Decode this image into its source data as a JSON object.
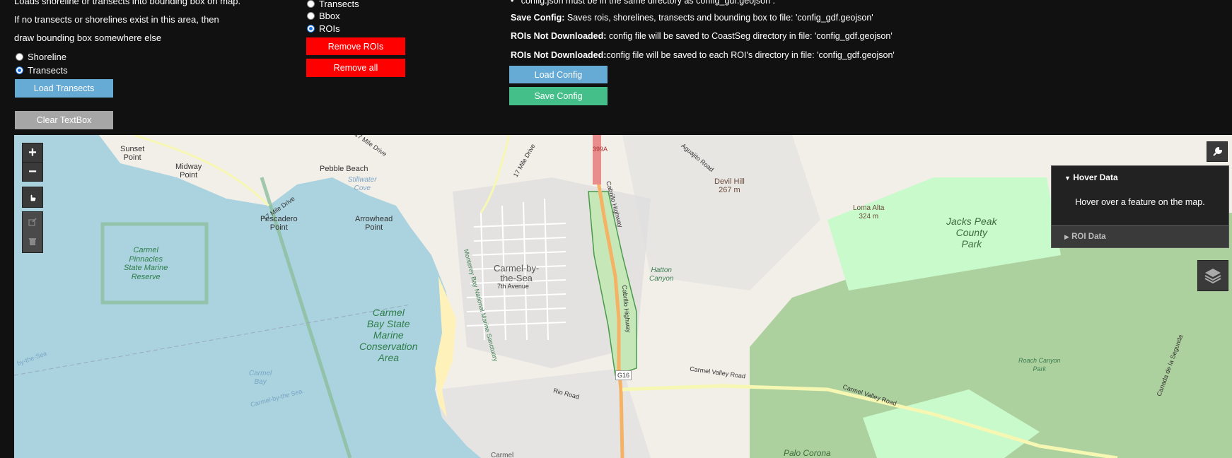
{
  "left_panel": {
    "line1": "Loads shoreline or transects into bounding box on map.",
    "line2": "If no transects or shorelines exist in this area, then",
    "line3": "draw bounding box somewhere else",
    "radio_options": [
      {
        "label": "Shoreline",
        "selected": false
      },
      {
        "label": "Transects",
        "selected": true
      }
    ],
    "load_button": "Load Transects",
    "clear_button": "Clear TextBox"
  },
  "middle_panel": {
    "radio_options": [
      {
        "label": "Transects",
        "selected": false
      },
      {
        "label": "Bbox",
        "selected": false
      },
      {
        "label": "ROIs",
        "selected": true
      }
    ],
    "remove_rois_button": "Remove ROIs",
    "remove_all_button": "Remove all"
  },
  "right_panel": {
    "bullet_text": "config.json  must be in the same directory as  config_gdf.geojson .",
    "save_config_title": "Save Config:",
    "save_config_desc": " Saves rois, shorelines, transects and bounding box to file: 'config_gdf.geojson'",
    "not_downloaded_title_1": "ROIs Not Downloaded:",
    "not_downloaded_desc_1": " config file will be saved to CoastSeg directory in file: 'config_gdf.geojson'",
    "not_downloaded_title_2": "ROIs Not Downloaded:",
    "not_downloaded_desc_2": "config file will be saved to each ROI's directory in file: 'config_gdf.geojson'",
    "load_config_button": "Load Config",
    "save_config_button": "Save Config"
  },
  "map": {
    "zoom_in": "+",
    "zoom_out": "−",
    "hover_panel": {
      "title": "Hover Data",
      "message": "Hover over a feature on the map.",
      "roi_title": "ROI Data"
    },
    "labels": [
      {
        "text": "Sunset\nPoint"
      },
      {
        "text": "Midway\nPoint"
      },
      {
        "text": "Pebble Beach"
      },
      {
        "text": "Stillwater\nCove"
      },
      {
        "text": "Pescadero\nPoint"
      },
      {
        "text": "Arrowhead\nPoint"
      },
      {
        "text": "17 Mile Drive"
      },
      {
        "text": "17 Mile Drive"
      },
      {
        "text": "17 Mile Drive"
      },
      {
        "text": "399A"
      },
      {
        "text": "Aguajito Road"
      },
      {
        "text": "Cabrillo Highway"
      },
      {
        "text": "Devil Hill\n267 m"
      },
      {
        "text": "Loma Alta\n324 m"
      },
      {
        "text": "Carmel-by-\nthe-Sea"
      },
      {
        "text": "7th Avenue"
      },
      {
        "text": "Cabrillo Highway"
      },
      {
        "text": "Hatton\nCanyon"
      },
      {
        "text": "Monterey Bay National Marine Sanctuary"
      },
      {
        "text": "Carmel\nBay"
      },
      {
        "text": "Carmel-by-the Sea"
      },
      {
        "text": "by-the-Sea"
      },
      {
        "text": "G16"
      },
      {
        "text": "Carmel Valley Road"
      },
      {
        "text": "Carmel Valley Road"
      },
      {
        "text": "Rio Road"
      },
      {
        "text": "Carmel"
      },
      {
        "text": "Palo Corona"
      },
      {
        "text": "Roach Canyon\nPark"
      },
      {
        "text": "Canada de la Segunda"
      }
    ],
    "park_labels": [
      {
        "text": "Jacks Peak\nCounty\nPark"
      }
    ],
    "marine_labels": [
      {
        "text": "Carmel\nPinnacles\nState Marine\nReserve"
      },
      {
        "text": "Carmel\nBay State\nMarine\nConservation\nArea"
      }
    ]
  }
}
